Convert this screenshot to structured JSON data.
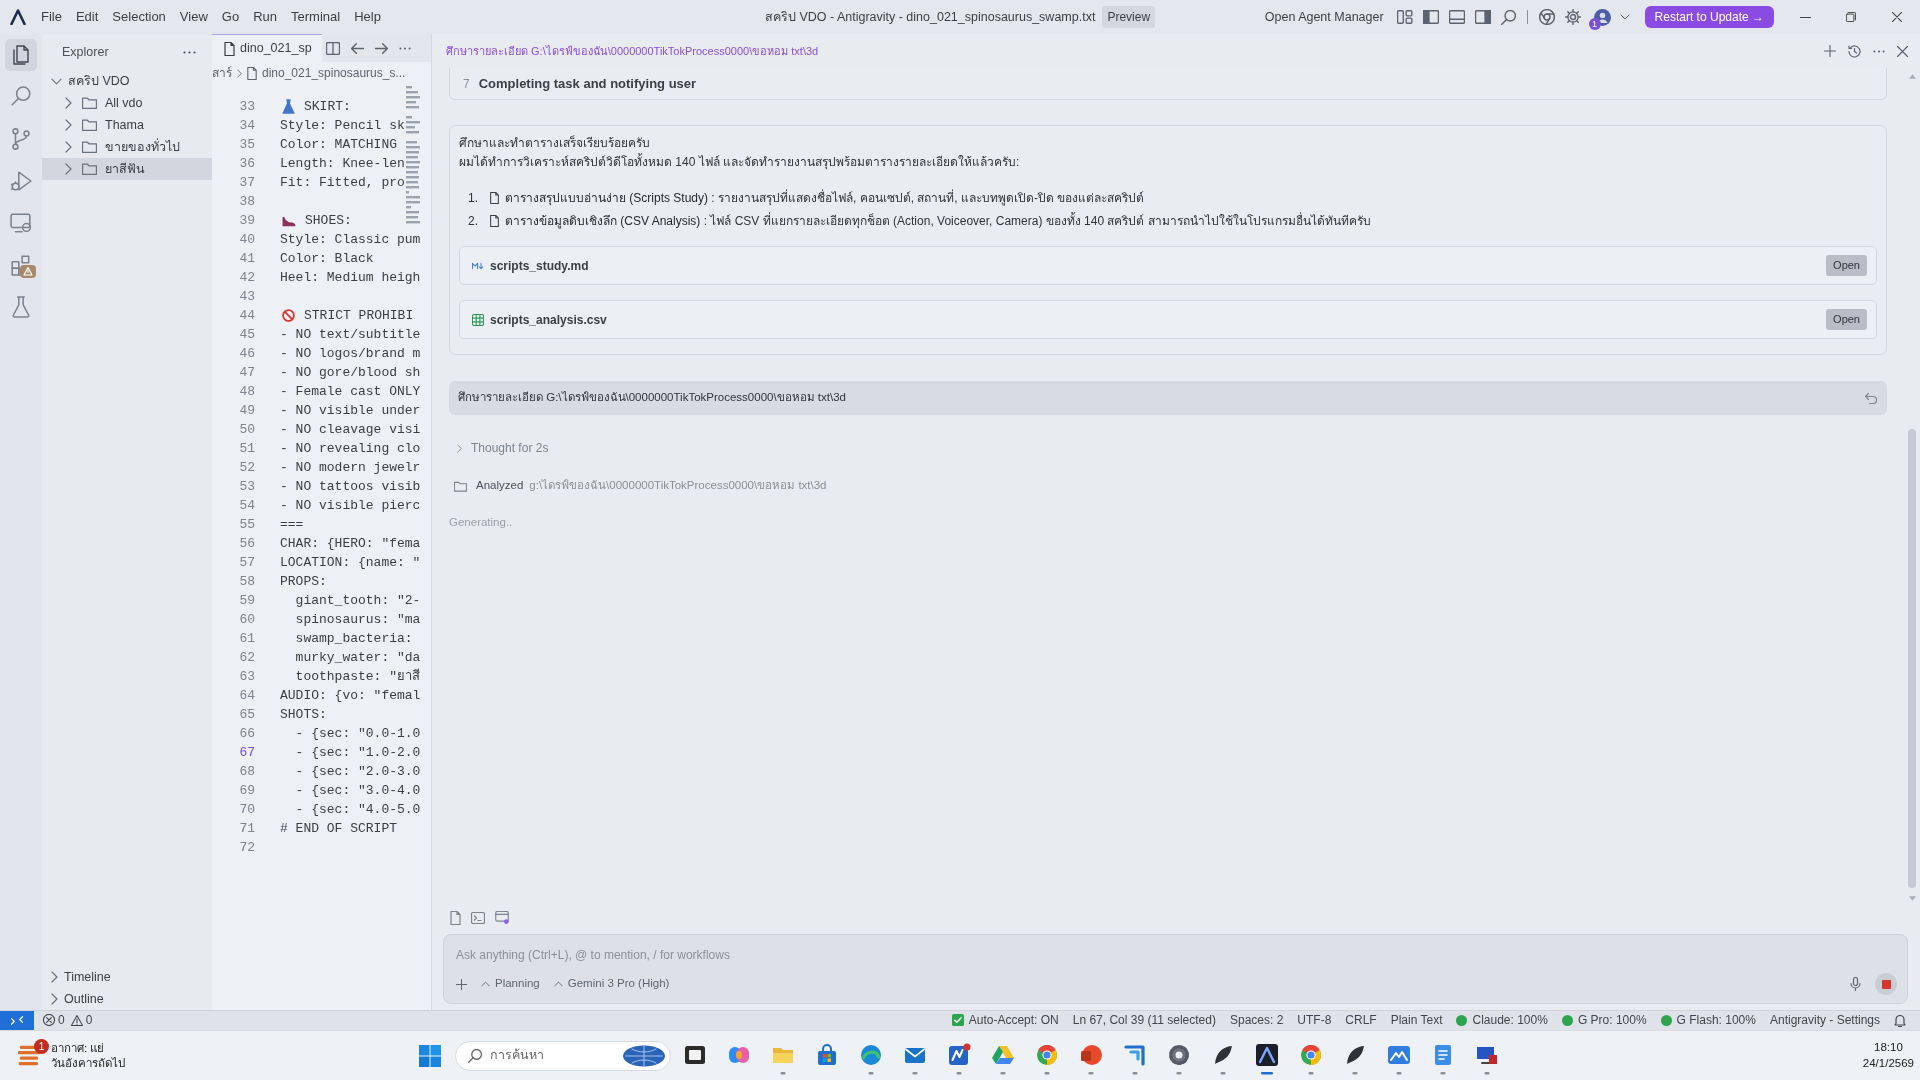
{
  "title_bar": {
    "menu": [
      "File",
      "Edit",
      "Selection",
      "View",
      "Go",
      "Run",
      "Terminal",
      "Help"
    ],
    "title": "สคริป VDO - Antigravity - dino_021_spinosaurus_swamp.txt",
    "badge": "Preview",
    "agent_manager": "Open Agent Manager",
    "layout_toggles": [
      {
        "kind": "customize",
        "on": false
      },
      {
        "kind": "primary_sidebar",
        "on": true
      },
      {
        "kind": "panel",
        "on": false
      },
      {
        "kind": "secondary_sidebar",
        "on": true
      }
    ],
    "account_badge": "1",
    "update_button": "Restart to Update →"
  },
  "activity_bar": [
    {
      "kind": "explorer",
      "selected": true,
      "alert": false
    },
    {
      "kind": "search",
      "selected": false,
      "alert": false
    },
    {
      "kind": "source_control",
      "selected": false,
      "alert": false
    },
    {
      "kind": "run_debug",
      "selected": false,
      "alert": false
    },
    {
      "kind": "remote",
      "selected": false,
      "alert": false
    },
    {
      "kind": "extensions",
      "selected": false,
      "alert": true
    },
    {
      "kind": "testing",
      "selected": false,
      "alert": false
    }
  ],
  "explorer": {
    "title": "Explorer",
    "tree": [
      {
        "label": "สคริป VDO",
        "expanded": true,
        "selected": false,
        "children": [
          {
            "label": "All vdo",
            "expanded": false,
            "selected": false
          },
          {
            "label": "Thama",
            "expanded": false,
            "selected": false
          },
          {
            "label": "ขายของทั่วไป",
            "expanded": false,
            "selected": false
          },
          {
            "label": "ยาสีฟัน",
            "expanded": false,
            "selected": true
          }
        ]
      }
    ],
    "sections": [
      {
        "label": "Timeline",
        "expanded": false
      },
      {
        "label": "Outline",
        "expanded": false
      }
    ]
  },
  "editor": {
    "tab": "dino_021_sp",
    "breadcrumb": [
      "สาร์",
      "dino_021_spinosaurus_s..."
    ],
    "lines": [
      {
        "number": "33",
        "kind": "dress",
        "text": "SKIRT:",
        "selected": false
      },
      {
        "number": "34",
        "kind": "text",
        "text": "Style: Pencil sk",
        "selected": false
      },
      {
        "number": "35",
        "kind": "text",
        "text": "Color: MATCHING",
        "selected": false
      },
      {
        "number": "36",
        "kind": "text",
        "text": "Length: Knee-len",
        "selected": false
      },
      {
        "number": "37",
        "kind": "text",
        "text": "Fit: Fitted, pro",
        "selected": false
      },
      {
        "number": "38",
        "kind": "text",
        "selected": false
      },
      {
        "number": "39",
        "kind": "heel",
        "text": "SHOES:",
        "selected": false
      },
      {
        "number": "40",
        "kind": "text",
        "text": "Style: Classic pum",
        "selected": false
      },
      {
        "number": "41",
        "kind": "text",
        "text": "Color: Black",
        "selected": false
      },
      {
        "number": "42",
        "kind": "text",
        "text": "Heel: Medium heigh",
        "selected": false
      },
      {
        "number": "43",
        "kind": "text",
        "selected": false
      },
      {
        "number": "44",
        "kind": "prohibited",
        "text": "STRICT PROHIBI",
        "selected": false
      },
      {
        "number": "45",
        "kind": "text",
        "text": "- NO text/subtitle",
        "selected": false
      },
      {
        "number": "46",
        "kind": "text",
        "text": "- NO logos/brand m",
        "selected": false
      },
      {
        "number": "47",
        "kind": "text",
        "text": "- NO gore/blood sh",
        "selected": false
      },
      {
        "number": "48",
        "kind": "text",
        "text": "- Female cast ONLY",
        "selected": false
      },
      {
        "number": "49",
        "kind": "text",
        "text": "- NO visible under",
        "selected": false
      },
      {
        "number": "50",
        "kind": "text",
        "text": "- NO cleavage visi",
        "selected": false
      },
      {
        "number": "51",
        "kind": "text",
        "text": "- NO revealing clo",
        "selected": false
      },
      {
        "number": "52",
        "kind": "text",
        "text": "- NO modern jewelr",
        "selected": false
      },
      {
        "number": "53",
        "kind": "text",
        "text": "- NO tattoos visib",
        "selected": false
      },
      {
        "number": "54",
        "kind": "text",
        "text": "- NO visible pierc",
        "selected": false
      },
      {
        "number": "55",
        "kind": "text",
        "text": "===",
        "selected": false
      },
      {
        "number": "56",
        "kind": "text",
        "text": "CHAR: {HERO: \"fema",
        "selected": false
      },
      {
        "number": "57",
        "kind": "text",
        "text": "LOCATION: {name: \"",
        "selected": false
      },
      {
        "number": "58",
        "kind": "text",
        "text": "PROPS:",
        "selected": false
      },
      {
        "number": "59",
        "kind": "text",
        "text": "  giant_tooth: \"2-",
        "selected": false
      },
      {
        "number": "60",
        "kind": "text",
        "text": "  spinosaurus: \"ma",
        "selected": false
      },
      {
        "number": "61",
        "kind": "text",
        "text": "  swamp_bacteria:",
        "selected": false
      },
      {
        "number": "62",
        "kind": "text",
        "text": "  murky_water: \"da",
        "selected": false
      },
      {
        "number": "63",
        "kind": "text",
        "text": "  toothpaste: \"ยาสี",
        "selected": false
      },
      {
        "number": "64",
        "kind": "text",
        "text": "AUDIO: {vo: \"femal",
        "selected": false
      },
      {
        "number": "65",
        "kind": "text",
        "text": "SHOTS:",
        "selected": false
      },
      {
        "number": "66",
        "kind": "text",
        "text": "  - {sec: \"0.0-1.0",
        "selected": false
      },
      {
        "number": "67",
        "kind": "text",
        "text": "  - {sec: \"1.0-2.0",
        "selected": true
      },
      {
        "number": "68",
        "kind": "text",
        "text": "  - {sec: \"2.0-3.0",
        "selected": false
      },
      {
        "number": "69",
        "kind": "text",
        "text": "  - {sec: \"3.0-4.0",
        "selected": false
      },
      {
        "number": "70",
        "kind": "text",
        "text": "  - {sec: \"4.0-5.0",
        "selected": false
      },
      {
        "number": "71",
        "kind": "text",
        "text": "# END OF SCRIPT",
        "selected": false
      },
      {
        "number": "72",
        "kind": "text",
        "selected": false
      }
    ]
  },
  "chat": {
    "header_path": "ศึกษารายละเอียด G:\\ไดรฟ์ของฉัน\\0000000TikTokProcess0000\\ขอหอม txt\\3d",
    "step": {
      "number": "7",
      "text": "Completing task and notifying user"
    },
    "response": {
      "heading": "ศึกษาและทำตารางเสร็จเรียบร้อยครับ",
      "intro": "ผมได้ทำการวิเคราะห์สคริปต์วิดีโอทั้งหมด 140 ไฟล์ และจัดทำรายงานสรุปพร้อมตารางรายละเอียดให้แล้วครับ:",
      "items": [
        {
          "number": "1.",
          "link": "ตารางสรุปแบบอ่านง่าย (Scripts Study)",
          "text": ": รายงานสรุปที่แสดงชื่อไฟล์, คอนเซปต์, สถานที่, และบทพูดเปิด-ปิด ของแต่ละสคริปต์"
        },
        {
          "number": "2.",
          "link": "ตารางข้อมูลดิบเชิงลึก (CSV Analysis)",
          "text": ": ไฟล์ CSV ที่แยกรายละเอียดทุกช็อต (Action, Voiceover, Camera) ของทั้ง 140 สคริปต์ สามารถนำไปใช้ในโปรแกรมอื่นได้ทันทีครับ"
        }
      ],
      "files": [
        {
          "kind": "markdown",
          "name": "scripts_study.md",
          "action": "Open"
        },
        {
          "kind": "csv",
          "name": "scripts_analysis.csv",
          "action": "Open"
        }
      ]
    },
    "user_message": "ศึกษารายละเอียด G:\\ไดรฟ์ของฉัน\\0000000TikTokProcess0000\\ขอหอม txt\\3d",
    "thought": {
      "label": "Thought for 2s",
      "expanded": false
    },
    "analyzed": {
      "label": "Analyzed",
      "path": "g:\\ไดรฟ์ของฉัน\\0000000TikTokProcess0000\\ขอหอม txt\\3d"
    },
    "status": "Generating..",
    "composer": {
      "placeholder": "Ask anything (Ctrl+L), @ to mention, / for workflows",
      "mode": "Planning",
      "model": "Gemini 3 Pro (High)"
    }
  },
  "status_bar": {
    "problems": {
      "errors": "0",
      "warnings": "0"
    },
    "items": [
      {
        "kind": "check",
        "text": "Auto-Accept: ON"
      },
      {
        "kind": "plain",
        "text": "Ln 67, Col 39 (11 selected)"
      },
      {
        "kind": "plain",
        "text": "Spaces: 2"
      },
      {
        "kind": "plain",
        "text": "UTF-8"
      },
      {
        "kind": "plain",
        "text": "CRLF"
      },
      {
        "kind": "plain",
        "text": "Plain Text"
      },
      {
        "kind": "dot",
        "text": "Claude: 100%",
        "color": "#2da44e"
      },
      {
        "kind": "dot",
        "text": "G Pro: 100%",
        "color": "#2da44e"
      },
      {
        "kind": "dot",
        "text": "G Flash: 100%",
        "color": "#2da44e"
      },
      {
        "kind": "plain",
        "text": "Antigravity - Settings"
      }
    ]
  },
  "taskbar": {
    "weather": {
      "badge": "1",
      "condition": "อากาศ: แย่",
      "forecast": "วันอังคารถัดไป"
    },
    "search": {
      "placeholder": "การค้นหา"
    },
    "apps": [
      {
        "kind": "task_view",
        "running": false,
        "selected": false
      },
      {
        "kind": "copilot",
        "running": false,
        "selected": false
      },
      {
        "kind": "folder",
        "running": true,
        "selected": false
      },
      {
        "kind": "store",
        "running": false,
        "selected": false
      },
      {
        "kind": "edge",
        "running": true,
        "selected": false
      },
      {
        "kind": "mail",
        "running": true,
        "selected": false
      },
      {
        "kind": "zigzag",
        "running": true,
        "selected": false
      },
      {
        "kind": "drive",
        "running": true,
        "selected": false
      },
      {
        "kind": "chrome",
        "running": true,
        "selected": false
      },
      {
        "kind": "red_circle",
        "running": true,
        "selected": false
      },
      {
        "kind": "bracket",
        "running": true,
        "selected": false
      },
      {
        "kind": "gear",
        "running": true,
        "selected": false
      },
      {
        "kind": "feather",
        "running": true,
        "selected": false
      },
      {
        "kind": "antigravity",
        "running": true,
        "selected": true
      },
      {
        "kind": "chrome",
        "running": true,
        "selected": false
      },
      {
        "kind": "feather",
        "running": true,
        "selected": false
      },
      {
        "kind": "mountain",
        "running": true,
        "selected": false
      },
      {
        "kind": "notepad",
        "running": true,
        "selected": false
      },
      {
        "kind": "monitor",
        "running": true,
        "selected": false
      }
    ],
    "clock": {
      "time": "18:10",
      "date": "24/1/2569"
    }
  }
}
